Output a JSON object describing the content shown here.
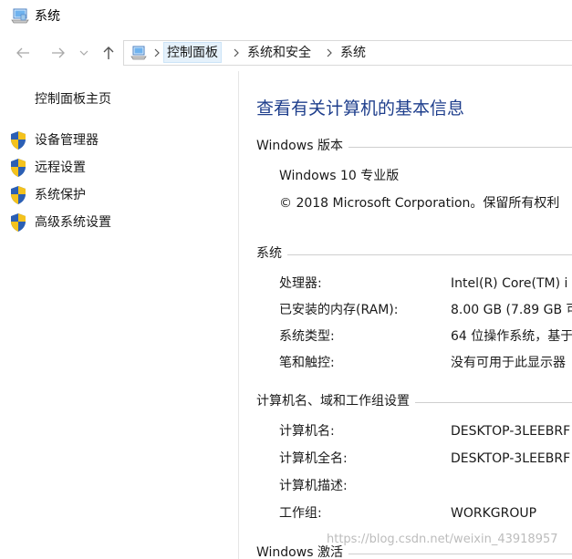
{
  "window": {
    "title": "系统",
    "icon": "computer-icon"
  },
  "nav": {
    "back_icon": "arrow-left-icon",
    "forward_icon": "arrow-right-icon",
    "recent_icon": "chevron-down-icon",
    "up_icon": "arrow-up-icon"
  },
  "breadcrumb": {
    "items": [
      "控制面板",
      "系统和安全",
      "系统"
    ]
  },
  "sidebar": {
    "home": "控制面板主页",
    "items": [
      {
        "label": "设备管理器",
        "icon": "shield-icon"
      },
      {
        "label": "远程设置",
        "icon": "shield-icon"
      },
      {
        "label": "系统保护",
        "icon": "shield-icon"
      },
      {
        "label": "高级系统设置",
        "icon": "shield-icon"
      }
    ]
  },
  "main": {
    "title": "查看有关计算机的基本信息",
    "edition": {
      "heading": "Windows 版本",
      "name": "Windows 10 专业版",
      "copyright": "© 2018 Microsoft Corporation。保留所有权利"
    },
    "system": {
      "heading": "系统",
      "rows": [
        {
          "label": "处理器:",
          "value": "Intel(R) Core(TM) i"
        },
        {
          "label": "已安装的内存(RAM):",
          "value": "8.00 GB (7.89 GB 可"
        },
        {
          "label": "系统类型:",
          "value": "64 位操作系统，基于"
        },
        {
          "label": "笔和触控:",
          "value": "没有可用于此显示器"
        }
      ]
    },
    "computer": {
      "heading": "计算机名、域和工作组设置",
      "rows": [
        {
          "label": "计算机名:",
          "value": "DESKTOP-3LEEBRF"
        },
        {
          "label": "计算机全名:",
          "value": "DESKTOP-3LEEBRF"
        },
        {
          "label": "计算机描述:",
          "value": ""
        },
        {
          "label": "工作组:",
          "value": "WORKGROUP"
        }
      ]
    },
    "activation": {
      "heading": "Windows 激活"
    }
  },
  "watermark": "https://blog.csdn.net/weixin_43918957",
  "colors": {
    "title_blue": "#1e3e8c",
    "shield_blue": "#2b5fb4",
    "shield_yellow": "#f4c21d"
  }
}
